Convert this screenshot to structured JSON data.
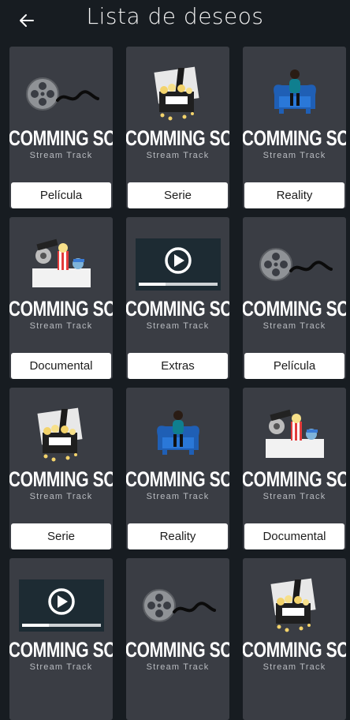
{
  "header": {
    "title": "Lista de deseos",
    "back_icon": "arrow-left-icon"
  },
  "card_common": {
    "overlay": "COMMING SOON",
    "brand": "Stream Track"
  },
  "cards": [
    {
      "label": "Película",
      "art": "film-reel-icon"
    },
    {
      "label": "Serie",
      "art": "clapper-popcorn-icon"
    },
    {
      "label": "Reality",
      "art": "person-armchair-icon"
    },
    {
      "label": "Documental",
      "art": "cinema-props-icon"
    },
    {
      "label": "Extras",
      "art": "video-player-icon"
    },
    {
      "label": "Película",
      "art": "film-reel-icon"
    },
    {
      "label": "Serie",
      "art": "clapper-popcorn-icon"
    },
    {
      "label": "Reality",
      "art": "person-armchair-icon"
    },
    {
      "label": "Documental",
      "art": "cinema-props-icon"
    },
    {
      "label": "",
      "art": "video-player-icon"
    },
    {
      "label": "",
      "art": "film-reel-icon"
    },
    {
      "label": "",
      "art": "clapper-popcorn-icon"
    }
  ],
  "colors": {
    "background": "#171c21",
    "card": "#3a3d44",
    "label_bg": "#ffffff"
  }
}
